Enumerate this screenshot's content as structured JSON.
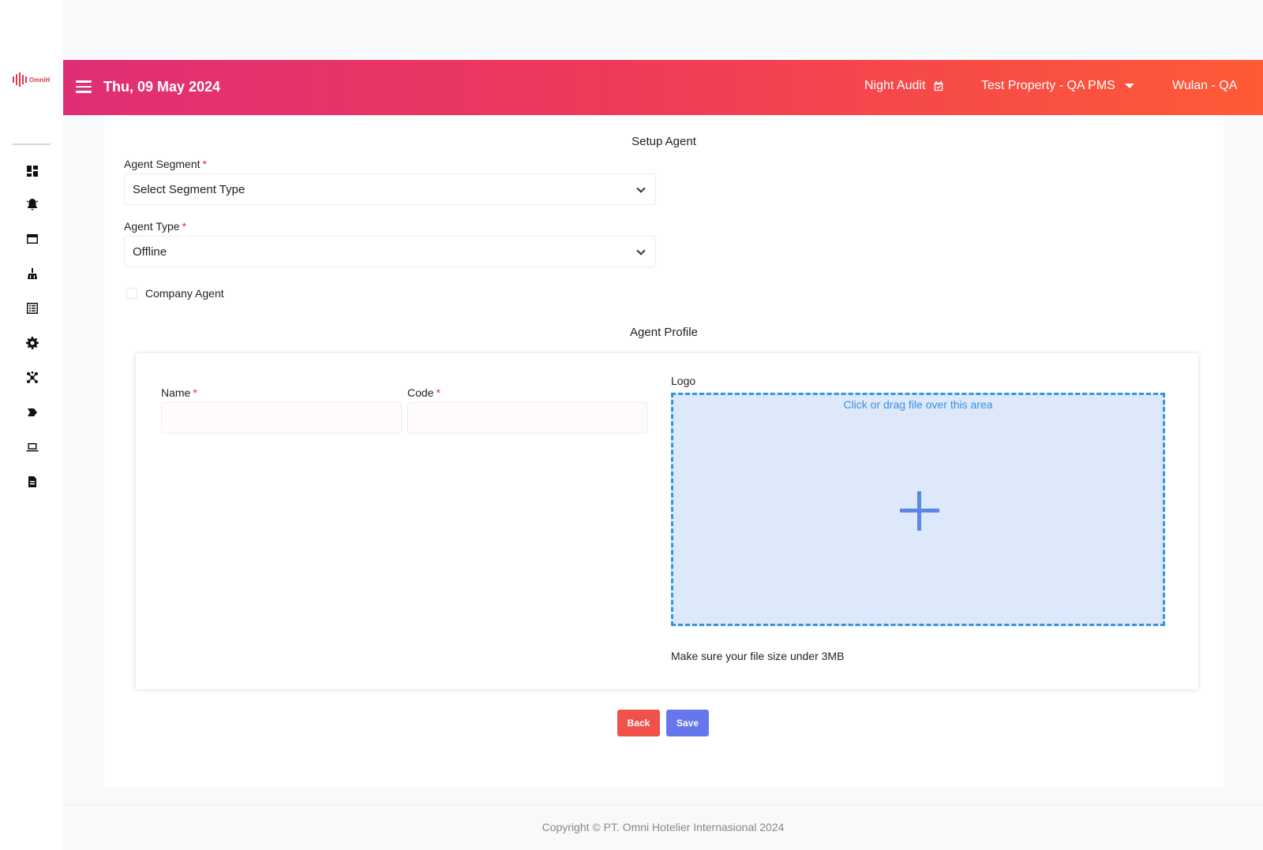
{
  "brand": {
    "logo_text": "OmniH"
  },
  "sidebar": {
    "items": [
      {
        "icon": "dashboard-icon"
      },
      {
        "icon": "bell-icon"
      },
      {
        "icon": "window-icon"
      },
      {
        "icon": "housekeeping-icon"
      },
      {
        "icon": "list-icon"
      },
      {
        "icon": "gear-icon"
      },
      {
        "icon": "network-icon"
      },
      {
        "icon": "tag-icon"
      },
      {
        "icon": "laptop-icon"
      },
      {
        "icon": "report-icon"
      }
    ]
  },
  "header": {
    "date": "Thu, 09 May 2024",
    "night_audit": "Night Audit",
    "property": "Test Property - QA PMS",
    "user": "Wulan - QA",
    "gradient_start": "#e02e76",
    "gradient_end": "#ff5a36"
  },
  "setup": {
    "title": "Setup Agent",
    "segment_label": "Agent Segment",
    "segment_value": "Select Segment Type",
    "type_label": "Agent Type",
    "type_value": "Offline",
    "company_agent_label": "Company Agent",
    "required_mark": "*"
  },
  "profile": {
    "title": "Agent Profile",
    "name_label": "Name",
    "code_label": "Code",
    "logo_label": "Logo",
    "dropzone_text": "Click or drag file over this area",
    "hint": "Make sure your file size under 3MB"
  },
  "actions": {
    "back_label": "Back",
    "save_label": "Save",
    "back_color": "#f0524a",
    "save_color": "#6677ee"
  },
  "footer": {
    "copyright": "Copyright © PT. Omni Hotelier Internasional 2024"
  }
}
